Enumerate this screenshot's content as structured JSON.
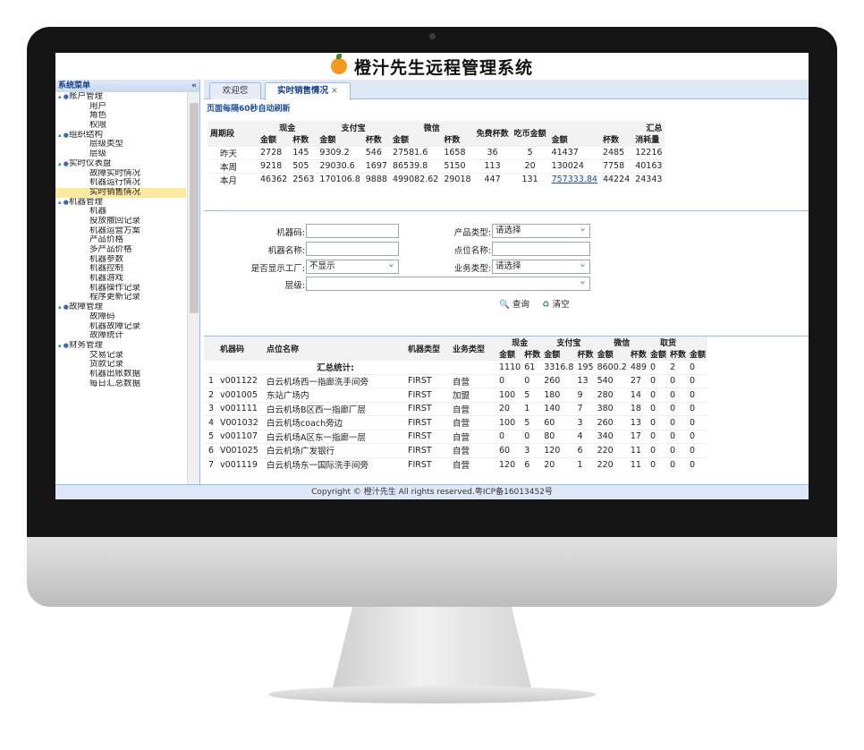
{
  "app_title": "橙汁先生远程管理系统",
  "sidebar": {
    "title": "系统菜单",
    "collapse_icon": "«",
    "groups": [
      {
        "label": "账户管理",
        "items": [
          "用户",
          "角色",
          "权限"
        ]
      },
      {
        "label": "组织结构",
        "items": [
          "层级类型",
          "层级"
        ]
      },
      {
        "label": "实时仪表盘",
        "items": [
          "故障实时情况",
          "机器运行情况",
          "实时销售情况"
        ]
      },
      {
        "label": "机器管理",
        "items": [
          "机器",
          "投放撤回记录",
          "机器运营方案",
          "产品价格",
          "多产品价格",
          "机器参数",
          "机器控制",
          "机器游戏",
          "机器操作记录",
          "程序更新记录"
        ]
      },
      {
        "label": "故障管理",
        "items": [
          "故障码",
          "机器故障记录",
          "故障统计"
        ]
      },
      {
        "label": "财务管理",
        "items": [
          "交易记录",
          "货款记录",
          "机器出账数据",
          "每日汇总数据"
        ]
      }
    ],
    "selected": "实时销售情况"
  },
  "tabs": [
    {
      "label": "欢迎您"
    },
    {
      "label": "实时销售情况",
      "close": "×"
    }
  ],
  "refresh_note": "页面每隔60秒自动刷新",
  "summary": {
    "period_header": "周期段",
    "group_headers": [
      "现金",
      "支付宝",
      "微信",
      "免费杯数",
      "吃币金额",
      "汇总"
    ],
    "sub_headers": [
      "金额",
      "杯数",
      "金额",
      "杯数",
      "金额",
      "杯数",
      "金额",
      "杯数",
      "消耗量"
    ],
    "rows": [
      [
        "昨天",
        "2728",
        "145",
        "9309.2",
        "546",
        "27581.6",
        "1658",
        "36",
        "5",
        "41437",
        "2485",
        "12216"
      ],
      [
        "本周",
        "9218",
        "505",
        "29030.6",
        "1697",
        "86539.8",
        "5150",
        "113",
        "20",
        "130024",
        "7758",
        "40163"
      ],
      [
        "本月",
        "46362",
        "2563",
        "170106.8",
        "9888",
        "499082.62",
        "29018",
        "447",
        "131",
        "757333.84",
        "44224",
        "24343"
      ]
    ]
  },
  "filters": {
    "machine_code_label": "机器码:",
    "machine_name_label": "机器名称:",
    "show_factory_label": "是否显示工厂:",
    "show_factory_value": "不显示",
    "level_label": "层级:",
    "product_type_label": "产品类型:",
    "product_type_value": "请选择",
    "location_label": "点位名称:",
    "business_type_label": "业务类型:",
    "business_type_value": "请选择",
    "search_label": "查询",
    "clear_label": "清空"
  },
  "detail": {
    "headers": [
      "机器码",
      "点位名称",
      "机器类型",
      "业务类型"
    ],
    "groups": [
      "现金",
      "支付宝",
      "微信",
      "取货"
    ],
    "sub_headers": [
      "金额",
      "杯数",
      "金额",
      "杯数",
      "金额",
      "杯数",
      "金额",
      "杯数",
      "金额"
    ],
    "total_label": "汇总统计:",
    "total": [
      "1110",
      "61",
      "3316.8",
      "195",
      "8600.2",
      "489",
      "0",
      "2",
      "0"
    ],
    "rows": [
      [
        "1",
        "v001122",
        "白云机场西一指廊洗手间旁",
        "FIRST",
        "自营",
        "0",
        "0",
        "260",
        "13",
        "540",
        "27",
        "0",
        "0",
        "0"
      ],
      [
        "2",
        "v001005",
        "东站广场内",
        "FIRST",
        "加盟",
        "100",
        "5",
        "180",
        "9",
        "280",
        "14",
        "0",
        "0",
        "0"
      ],
      [
        "3",
        "v001111",
        "白云机场B区西一指廊厂层",
        "FIRST",
        "自营",
        "20",
        "1",
        "140",
        "7",
        "380",
        "18",
        "0",
        "0",
        "0"
      ],
      [
        "4",
        "V001032",
        "白云机场coach旁边",
        "FIRST",
        "自营",
        "100",
        "5",
        "60",
        "3",
        "260",
        "13",
        "0",
        "0",
        "0"
      ],
      [
        "5",
        "v001107",
        "白云机场A区东一指廊一层",
        "FIRST",
        "自营",
        "0",
        "0",
        "80",
        "4",
        "340",
        "17",
        "0",
        "0",
        "0"
      ],
      [
        "6",
        "V001025",
        "白云机场广发银行",
        "FIRST",
        "自营",
        "60",
        "3",
        "120",
        "6",
        "220",
        "11",
        "0",
        "0",
        "0"
      ],
      [
        "7",
        "v001119",
        "白云机场东一国际洗手间旁",
        "FIRST",
        "自营",
        "120",
        "6",
        "20",
        "1",
        "220",
        "11",
        "0",
        "0",
        "0"
      ]
    ]
  },
  "footer": "Copyright © 橙汁先生 All rights reserved.粤ICP备16013452号"
}
